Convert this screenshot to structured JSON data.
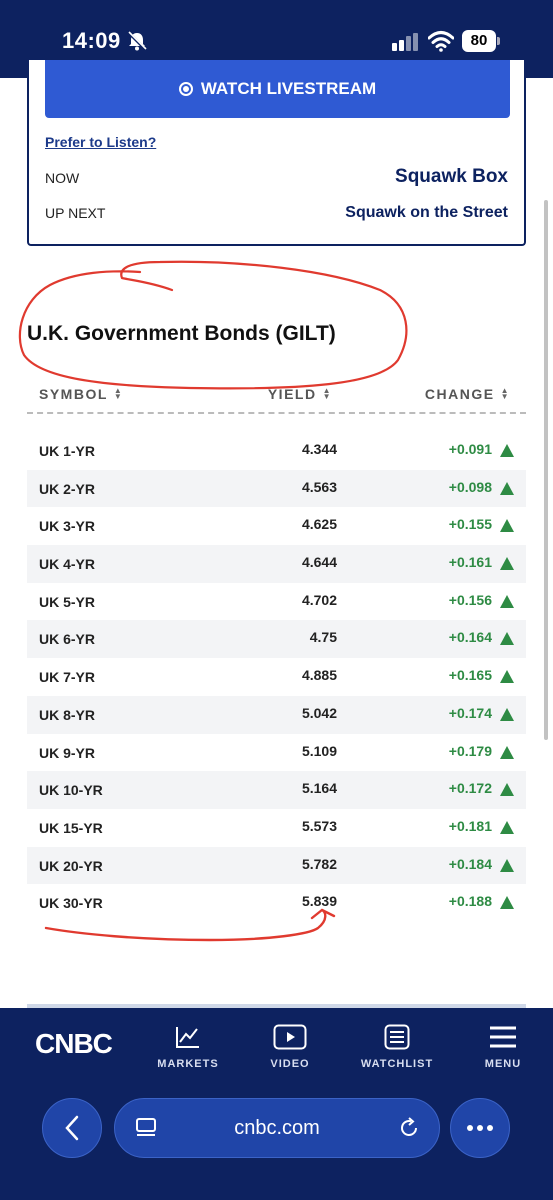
{
  "status_bar": {
    "time": "14:09",
    "battery": "80"
  },
  "live_card": {
    "watch_label": "WATCH LIVESTREAM",
    "listen_link": "Prefer to Listen?",
    "now_label": "NOW",
    "now_show": "Squawk Box",
    "next_label": "UP NEXT",
    "next_show": "Squawk on the Street"
  },
  "section": {
    "title": "U.K. Government Bonds (GILT)"
  },
  "table": {
    "headers": {
      "symbol": "SYMBOL",
      "yield": "YIELD",
      "change": "CHANGE"
    },
    "rows": [
      {
        "symbol": "UK 1-YR",
        "yield": "4.344",
        "change": "+0.091"
      },
      {
        "symbol": "UK 2-YR",
        "yield": "4.563",
        "change": "+0.098"
      },
      {
        "symbol": "UK 3-YR",
        "yield": "4.625",
        "change": "+0.155"
      },
      {
        "symbol": "UK 4-YR",
        "yield": "4.644",
        "change": "+0.161"
      },
      {
        "symbol": "UK 5-YR",
        "yield": "4.702",
        "change": "+0.156"
      },
      {
        "symbol": "UK 6-YR",
        "yield": "4.75",
        "change": "+0.164"
      },
      {
        "symbol": "UK 7-YR",
        "yield": "4.885",
        "change": "+0.165"
      },
      {
        "symbol": "UK 8-YR",
        "yield": "5.042",
        "change": "+0.174"
      },
      {
        "symbol": "UK 9-YR",
        "yield": "5.109",
        "change": "+0.179"
      },
      {
        "symbol": "UK 10-YR",
        "yield": "5.164",
        "change": "+0.172"
      },
      {
        "symbol": "UK 15-YR",
        "yield": "5.573",
        "change": "+0.181"
      },
      {
        "symbol": "UK 20-YR",
        "yield": "5.782",
        "change": "+0.184"
      },
      {
        "symbol": "UK 30-YR",
        "yield": "5.839",
        "change": "+0.188"
      }
    ]
  },
  "bottom_nav": {
    "logo": "CNBC",
    "items": [
      {
        "label": "MARKETS",
        "icon": "chart-line-icon"
      },
      {
        "label": "VIDEO",
        "icon": "play-icon"
      },
      {
        "label": "WATCHLIST",
        "icon": "list-icon"
      },
      {
        "label": "MENU",
        "icon": "hamburger-icon"
      }
    ]
  },
  "browser": {
    "url": "cnbc.com"
  },
  "colors": {
    "navy": "#0d2260",
    "blue_button": "#2f5ad3",
    "positive": "#2e8b44",
    "annotation_red": "#e03a2f"
  }
}
